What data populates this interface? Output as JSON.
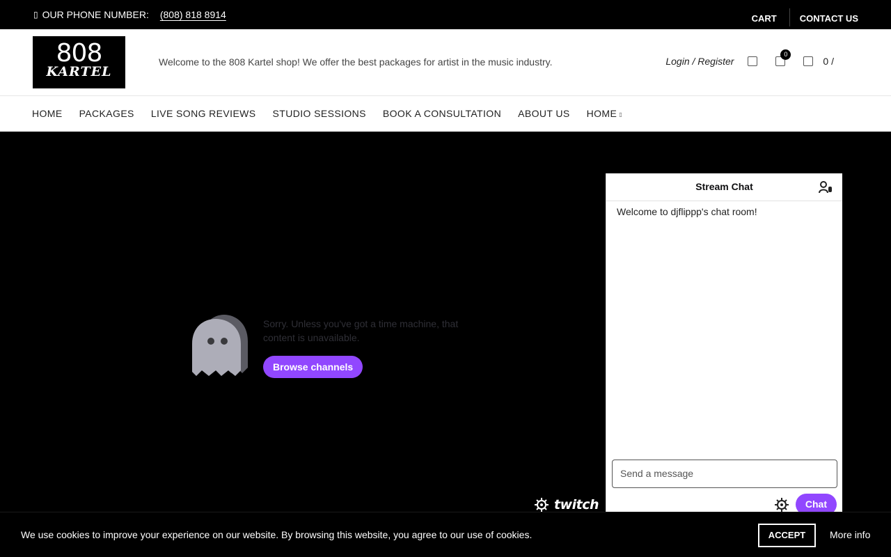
{
  "topbar": {
    "phone_icon": "phone-icon",
    "phone_label": "OUR PHONE NUMBER:",
    "phone_number": "(808) 818 8914",
    "cart": "CART",
    "contact": "CONTACT US"
  },
  "header": {
    "logo_top": "808",
    "logo_bottom": "KARTEL",
    "welcome": "Welcome to the 808 Kartel shop! We offer the best packages for artist in the music industry.",
    "login": "Login / Register",
    "compare_count": "0",
    "cart_total": "0 /"
  },
  "nav": {
    "items": [
      "HOME",
      "PACKAGES",
      "LIVE SONG REVIEWS",
      "STUDIO SESSIONS",
      "BOOK A CONSULTATION",
      "ABOUT US",
      "HOME"
    ]
  },
  "player": {
    "sorry": "Sorry. Unless you've got a time machine, that content is unavailable.",
    "browse": "Browse channels",
    "brand": "twitch"
  },
  "chat": {
    "title": "Stream Chat",
    "welcome": "Welcome to djflippp's chat room!",
    "placeholder": "Send a message",
    "chat_button": "Chat"
  },
  "cookie": {
    "text": "We use cookies to improve your experience on our website. By browsing this website, you agree to our use of cookies.",
    "accept": "ACCEPT",
    "more": "More info"
  },
  "colors": {
    "twitch_purple": "#9147ff",
    "background": "#000000"
  }
}
